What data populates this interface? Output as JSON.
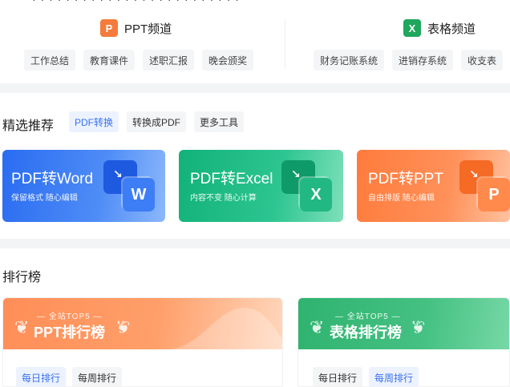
{
  "channels": {
    "ppt": {
      "icon": "ppt-icon",
      "icon_glyph": "P",
      "title": "PPT频道",
      "tags": [
        "工作总结",
        "教育课件",
        "述职汇报",
        "晚会颁奖"
      ]
    },
    "excel": {
      "icon": "excel-icon",
      "icon_glyph": "X",
      "title": "表格频道",
      "tags": [
        "财务记账系统",
        "进销存系统",
        "收支表"
      ]
    }
  },
  "featured": {
    "title": "精选推荐",
    "pills": [
      "PDF转换",
      "转换成PDF",
      "更多工具"
    ],
    "active_pill": "PDF转换",
    "cards": [
      {
        "title": "PDF转Word",
        "subtitle": "保留格式 随心编辑",
        "badge": "W",
        "icon": "word-doc-icon",
        "color": "#2a6cf1"
      },
      {
        "title": "PDF转Excel",
        "subtitle": "内容不变 随心计算",
        "badge": "X",
        "icon": "excel-doc-icon",
        "color": "#12b27a"
      },
      {
        "title": "PDF转PPT",
        "subtitle": "自由排版 随心编辑",
        "badge": "P",
        "icon": "ppt-doc-icon",
        "color": "#ff7b3c"
      }
    ]
  },
  "ranking": {
    "title": "排行榜",
    "boards": [
      {
        "kicker": "全站TOP5",
        "title": "PPT排行榜",
        "tabs": [
          "每日排行",
          "每周排行"
        ],
        "active_tab": "每日排行",
        "color": "#ff8e57"
      },
      {
        "kicker": "全站TOP5",
        "title": "表格排行榜",
        "tabs": [
          "每日排行",
          "每周排行"
        ],
        "active_tab": "每周排行",
        "color": "#2fb36f"
      }
    ]
  }
}
